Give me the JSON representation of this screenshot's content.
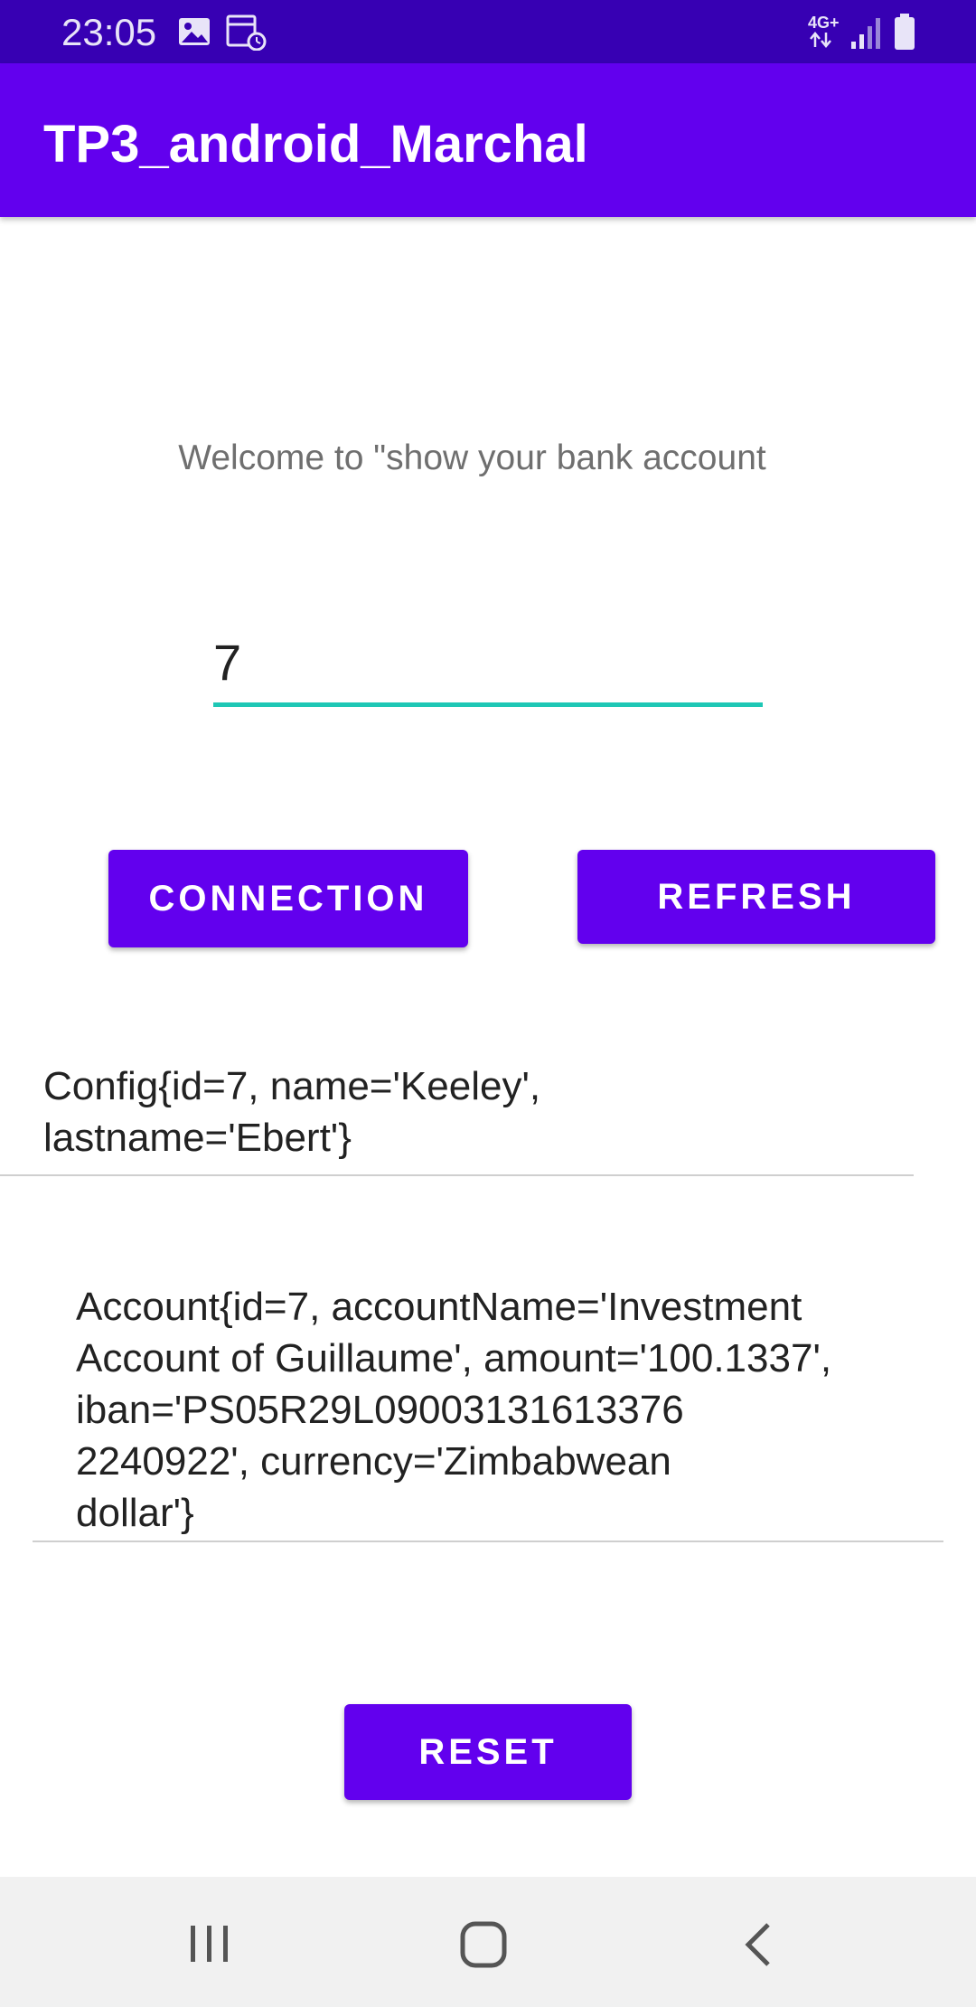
{
  "status_bar": {
    "time": "23:05",
    "icons": [
      "image-icon",
      "calendar-clock-icon",
      "4g-plus-icon",
      "signal-icon",
      "battery-icon"
    ],
    "network_label": "4G+"
  },
  "app_bar": {
    "title": "TP3_android_Marchal",
    "color": "#6200EE"
  },
  "welcome": {
    "text": "Welcome to \"show your bank account"
  },
  "id_input": {
    "value": "7",
    "underline_color": "#1EC7B5"
  },
  "buttons": {
    "connection": "CONNECTION",
    "refresh": "REFRESH",
    "reset": "RESET"
  },
  "config": {
    "line1": "Config{id=7, name='Keeley',",
    "line2": "lastname='Ebert'}"
  },
  "account": {
    "line1": "Account{id=7, accountName='Investment",
    "line2": "Account of Guillaume', amount='100.1337',",
    "line3": "iban='PS05R29L09003131613376",
    "line4": "2240922', currency='Zimbabwean",
    "line5": "dollar'}"
  },
  "nav_bar": {
    "icons": [
      "recents-icon",
      "home-icon",
      "back-icon"
    ]
  }
}
